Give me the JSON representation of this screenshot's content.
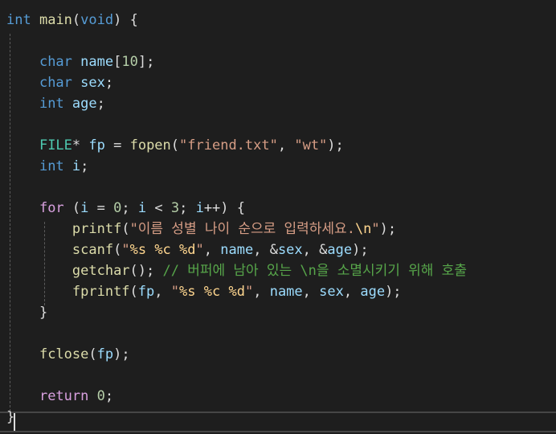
{
  "code_lines": [
    [
      {
        "t": "int",
        "c": "kw"
      },
      {
        "t": " ",
        "c": "pun"
      },
      {
        "t": "main",
        "c": "fn"
      },
      {
        "t": "(",
        "c": "pun"
      },
      {
        "t": "void",
        "c": "kw"
      },
      {
        "t": ") {",
        "c": "pun"
      }
    ],
    [],
    [
      {
        "t": "    ",
        "c": "pun"
      },
      {
        "t": "char",
        "c": "kw"
      },
      {
        "t": " ",
        "c": "pun"
      },
      {
        "t": "name",
        "c": "var"
      },
      {
        "t": "[",
        "c": "pun"
      },
      {
        "t": "10",
        "c": "num"
      },
      {
        "t": "];",
        "c": "pun"
      }
    ],
    [
      {
        "t": "    ",
        "c": "pun"
      },
      {
        "t": "char",
        "c": "kw"
      },
      {
        "t": " ",
        "c": "pun"
      },
      {
        "t": "sex",
        "c": "var"
      },
      {
        "t": ";",
        "c": "pun"
      }
    ],
    [
      {
        "t": "    ",
        "c": "pun"
      },
      {
        "t": "int",
        "c": "kw"
      },
      {
        "t": " ",
        "c": "pun"
      },
      {
        "t": "age",
        "c": "var"
      },
      {
        "t": ";",
        "c": "pun"
      }
    ],
    [],
    [
      {
        "t": "    ",
        "c": "pun"
      },
      {
        "t": "FILE",
        "c": "type"
      },
      {
        "t": "* ",
        "c": "pun"
      },
      {
        "t": "fp",
        "c": "var"
      },
      {
        "t": " = ",
        "c": "pun"
      },
      {
        "t": "fopen",
        "c": "fn"
      },
      {
        "t": "(",
        "c": "pun"
      },
      {
        "t": "\"friend.txt\"",
        "c": "str"
      },
      {
        "t": ", ",
        "c": "pun"
      },
      {
        "t": "\"wt\"",
        "c": "str"
      },
      {
        "t": ");",
        "c": "pun"
      }
    ],
    [
      {
        "t": "    ",
        "c": "pun"
      },
      {
        "t": "int",
        "c": "kw"
      },
      {
        "t": " ",
        "c": "pun"
      },
      {
        "t": "i",
        "c": "var"
      },
      {
        "t": ";",
        "c": "pun"
      }
    ],
    [],
    [
      {
        "t": "    ",
        "c": "pun"
      },
      {
        "t": "for",
        "c": "ctl"
      },
      {
        "t": " (",
        "c": "pun"
      },
      {
        "t": "i",
        "c": "var"
      },
      {
        "t": " = ",
        "c": "pun"
      },
      {
        "t": "0",
        "c": "num"
      },
      {
        "t": "; ",
        "c": "pun"
      },
      {
        "t": "i",
        "c": "var"
      },
      {
        "t": " < ",
        "c": "pun"
      },
      {
        "t": "3",
        "c": "num"
      },
      {
        "t": "; ",
        "c": "pun"
      },
      {
        "t": "i",
        "c": "var"
      },
      {
        "t": "++) {",
        "c": "pun"
      }
    ],
    [
      {
        "t": "        ",
        "c": "pun"
      },
      {
        "t": "printf",
        "c": "fn"
      },
      {
        "t": "(",
        "c": "pun"
      },
      {
        "t": "\"이름 성별 나이 순으로 입력하세요.",
        "c": "str"
      },
      {
        "t": "\\n",
        "c": "esc"
      },
      {
        "t": "\"",
        "c": "str"
      },
      {
        "t": ");",
        "c": "pun"
      }
    ],
    [
      {
        "t": "        ",
        "c": "pun"
      },
      {
        "t": "scanf",
        "c": "fn"
      },
      {
        "t": "(",
        "c": "pun"
      },
      {
        "t": "\"",
        "c": "str"
      },
      {
        "t": "%s",
        "c": "esc"
      },
      {
        "t": " ",
        "c": "str"
      },
      {
        "t": "%c",
        "c": "esc"
      },
      {
        "t": " ",
        "c": "str"
      },
      {
        "t": "%d",
        "c": "esc"
      },
      {
        "t": "\"",
        "c": "str"
      },
      {
        "t": ", ",
        "c": "pun"
      },
      {
        "t": "name",
        "c": "var"
      },
      {
        "t": ", &",
        "c": "pun"
      },
      {
        "t": "sex",
        "c": "var"
      },
      {
        "t": ", &",
        "c": "pun"
      },
      {
        "t": "age",
        "c": "var"
      },
      {
        "t": ");",
        "c": "pun"
      }
    ],
    [
      {
        "t": "        ",
        "c": "pun"
      },
      {
        "t": "getchar",
        "c": "fn"
      },
      {
        "t": "(); ",
        "c": "pun"
      },
      {
        "t": "// 버퍼에 남아 있는 \\n을 소멸시키기 위해 호출",
        "c": "cmt"
      }
    ],
    [
      {
        "t": "        ",
        "c": "pun"
      },
      {
        "t": "fprintf",
        "c": "fn"
      },
      {
        "t": "(",
        "c": "pun"
      },
      {
        "t": "fp",
        "c": "var"
      },
      {
        "t": ", ",
        "c": "pun"
      },
      {
        "t": "\"",
        "c": "str"
      },
      {
        "t": "%s",
        "c": "esc"
      },
      {
        "t": " ",
        "c": "str"
      },
      {
        "t": "%c",
        "c": "esc"
      },
      {
        "t": " ",
        "c": "str"
      },
      {
        "t": "%d",
        "c": "esc"
      },
      {
        "t": "\"",
        "c": "str"
      },
      {
        "t": ", ",
        "c": "pun"
      },
      {
        "t": "name",
        "c": "var"
      },
      {
        "t": ", ",
        "c": "pun"
      },
      {
        "t": "sex",
        "c": "var"
      },
      {
        "t": ", ",
        "c": "pun"
      },
      {
        "t": "age",
        "c": "var"
      },
      {
        "t": ");",
        "c": "pun"
      }
    ],
    [
      {
        "t": "    ",
        "c": "pun"
      },
      {
        "t": "}",
        "c": "pun"
      }
    ],
    [],
    [
      {
        "t": "    ",
        "c": "pun"
      },
      {
        "t": "fclose",
        "c": "fn"
      },
      {
        "t": "(",
        "c": "pun"
      },
      {
        "t": "fp",
        "c": "var"
      },
      {
        "t": ");",
        "c": "pun"
      }
    ],
    [],
    [
      {
        "t": "    ",
        "c": "pun"
      },
      {
        "t": "return",
        "c": "ctl"
      },
      {
        "t": " ",
        "c": "pun"
      },
      {
        "t": "0",
        "c": "num"
      },
      {
        "t": ";",
        "c": "pun"
      }
    ],
    [
      {
        "t": "}",
        "c": "pun"
      }
    ]
  ],
  "colors": {
    "background": "#1e1e1e",
    "keyword": "#569cd6",
    "control": "#d8a0df",
    "type": "#4ec9b0",
    "function": "#dcdcaa",
    "variable": "#9cdcfe",
    "string": "#d69d85",
    "escape": "#ffd68f",
    "number": "#b5cea8",
    "comment": "#57a64a",
    "punctuation": "#dcdcdc"
  }
}
